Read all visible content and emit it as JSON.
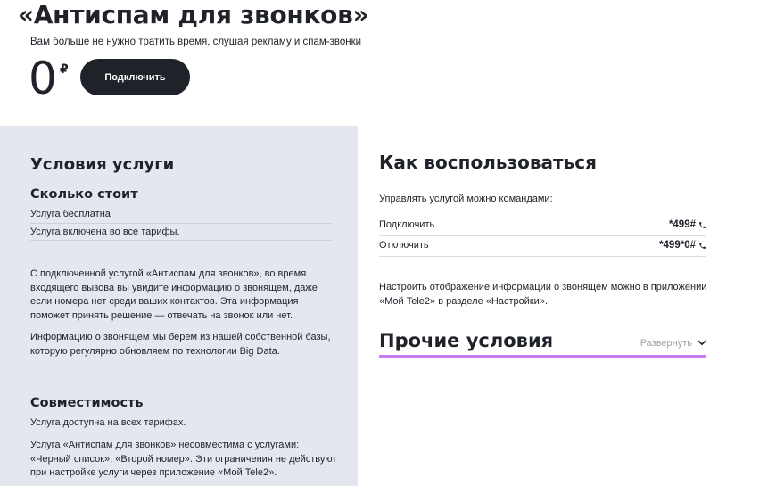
{
  "header": {
    "title": "«Антиспам для звонков»",
    "subtitle": "Вам больше не нужно тратить время, слушая рекламу и спам-звонки",
    "price": "0",
    "currency": "₽",
    "connect_label": "Подключить"
  },
  "conditions": {
    "title": "Условия услуги",
    "cost": {
      "title": "Сколько стоит",
      "line1": "Услуга бесплатна",
      "line2": "Услуга включена во все тарифы."
    },
    "description": {
      "p1": "С подключенной услугой «Антиспам для звонков», во время входящего вызова вы увидите информацию о звонящем, даже если номера нет среди ваших контактов. Эта информация поможет принять решение — отвечать на звонок или нет.",
      "p2": "Информацию о звонящем мы берем из нашей собственной базы, которую регулярно обновляем по технологии Big Data."
    },
    "compat": {
      "title": "Совместимость",
      "p1": "Услуга доступна на всех тарифах.",
      "p2": "Услуга «Антиспам для звонков» несовместима с услугами: «Черный список», «Второй номер». Эти ограничения не действуют при настройке услуги через приложение «Мой Tele2»."
    }
  },
  "howto": {
    "title": "Как воспользоваться",
    "intro": "Управлять услугой можно командами:",
    "commands": [
      {
        "label": "Подключить",
        "code": "*499#"
      },
      {
        "label": "Отключить",
        "code": "*499*0#"
      }
    ],
    "note": "Настроить отображение информации о звонящем можно в приложении «Мой Tele2» в разделе «Настройки»."
  },
  "other": {
    "title": "Прочие условия",
    "expand_label": "Развернуть"
  },
  "colors": {
    "accent_purple": "#c77df3",
    "dark": "#1f2229",
    "panel_gray": "#e5e7ee"
  }
}
